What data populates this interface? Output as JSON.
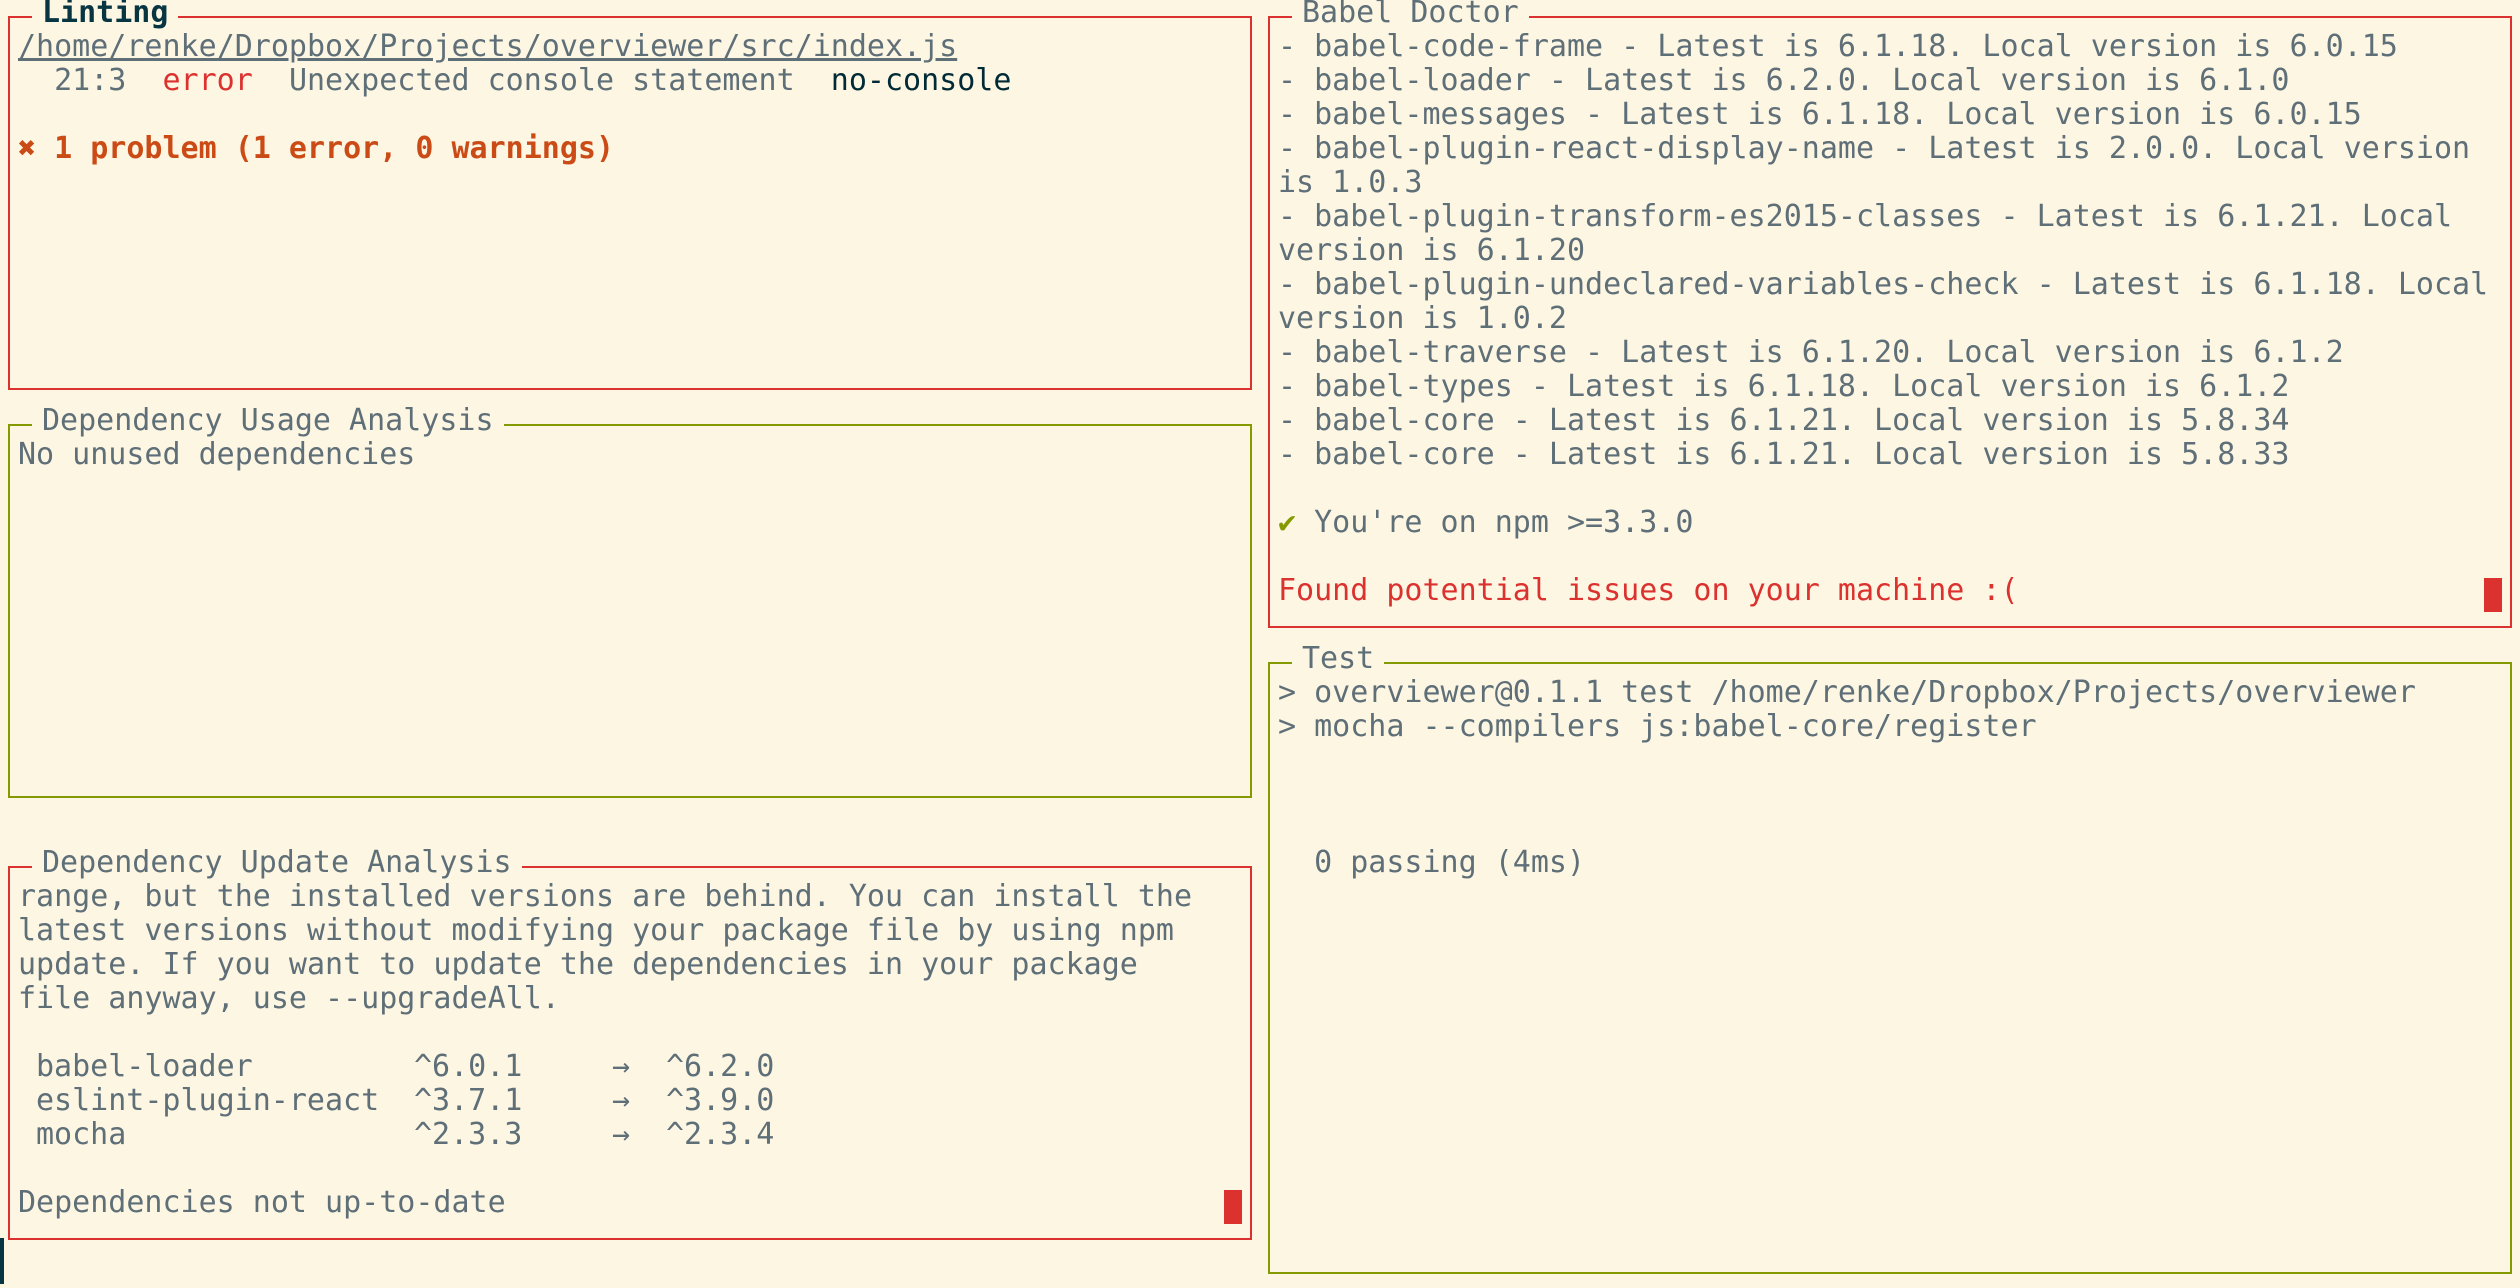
{
  "linting": {
    "title": "Linting",
    "file_path": "/home/renke/Dropbox/Projects/overviewer/src/index.js",
    "issue": {
      "position": "21:3",
      "severity": "error",
      "message": "Unexpected console statement",
      "rule": "no-console"
    },
    "summary_icon": "✖",
    "summary": "1 problem (1 error, 0 warnings)"
  },
  "babel_doctor": {
    "title": "Babel Doctor",
    "items": [
      "- babel-code-frame - Latest is 6.1.18. Local version is 6.0.15",
      "- babel-loader - Latest is 6.2.0. Local version is 6.1.0",
      "- babel-messages - Latest is 6.1.18. Local version is 6.0.15",
      "- babel-plugin-react-display-name - Latest is 2.0.0. Local version is 1.0.3",
      "- babel-plugin-transform-es2015-classes - Latest is 6.1.21. Local version is 6.1.20",
      "- babel-plugin-undeclared-variables-check - Latest is 6.1.18. Local version is 1.0.2",
      "- babel-traverse - Latest is 6.1.20. Local version is 6.1.2",
      "- babel-types - Latest is 6.1.18. Local version is 6.1.2",
      "- babel-core - Latest is 6.1.21. Local version is 5.8.34",
      "- babel-core - Latest is 6.1.21. Local version is 5.8.33"
    ],
    "check_icon": "✔",
    "npm_check": "You're on npm >=3.3.0",
    "result": "Found potential issues on your machine :("
  },
  "dep_usage": {
    "title": "Dependency Usage Analysis",
    "message": "No unused dependencies"
  },
  "dep_update": {
    "title": "Dependency Update Analysis",
    "lines": [
      "range, but the installed versions are behind. You can install the",
      "latest versions without modifying your package file by using npm",
      "update. If you want to update the dependencies in your package",
      "file anyway, use --upgradeAll."
    ],
    "arrow": "→",
    "packages": [
      {
        "name": "babel-loader",
        "current": "^6.0.1",
        "latest": "^6.2.0"
      },
      {
        "name": "eslint-plugin-react",
        "current": "^3.7.1",
        "latest": "^3.9.0"
      },
      {
        "name": "mocha",
        "current": "^2.3.3",
        "latest": "^2.3.4"
      }
    ],
    "status": "Dependencies not up-to-date"
  },
  "test": {
    "title": "Test",
    "lines": [
      "> overviewer@0.1.1 test /home/renke/Dropbox/Projects/overviewer",
      "> mocha --compilers js:babel-core/register"
    ],
    "result": "  0 passing (4ms)"
  }
}
